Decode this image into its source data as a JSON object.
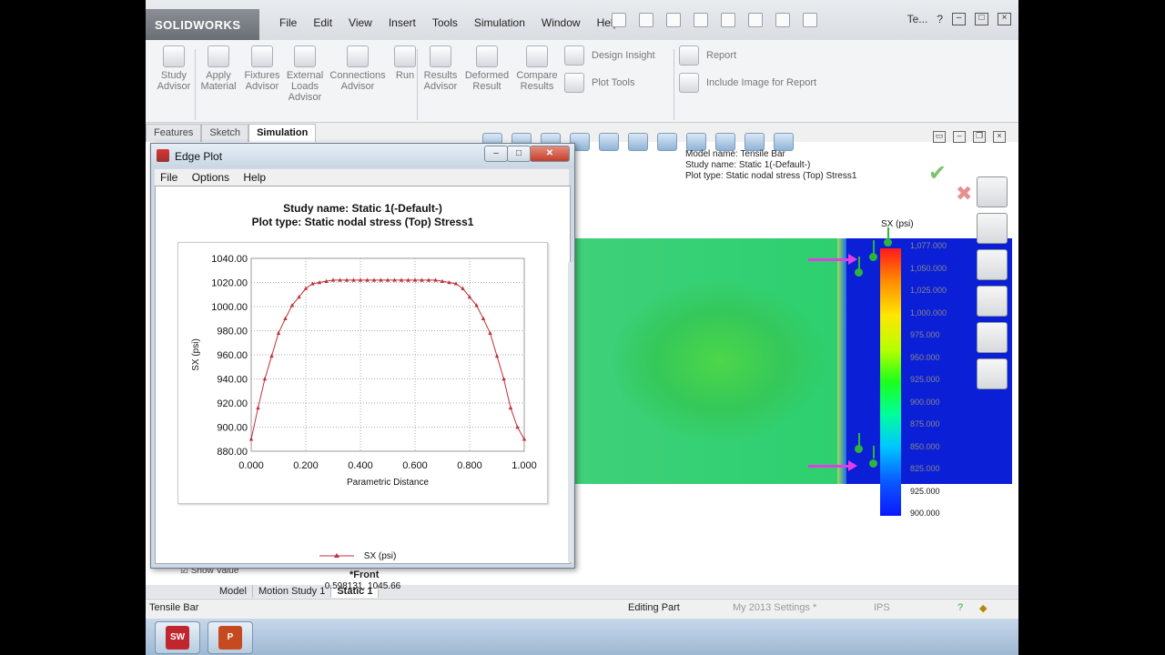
{
  "app": {
    "logo_text": "SOLIDWORKS",
    "menus": [
      "File",
      "Edit",
      "View",
      "Insert",
      "Tools",
      "Simulation",
      "Window",
      "Help"
    ],
    "doc_short": "Te...",
    "help_icon": "?"
  },
  "ribbon": {
    "buttons": [
      {
        "label": "Study\nAdvisor",
        "icon": "study-advisor-icon"
      },
      {
        "label": "Apply\nMaterial",
        "icon": "material-icon"
      },
      {
        "label": "Fixtures\nAdvisor",
        "icon": "fixtures-icon"
      },
      {
        "label": "External\nLoads\nAdvisor",
        "icon": "loads-icon"
      },
      {
        "label": "Connections\nAdvisor",
        "icon": "connections-icon"
      },
      {
        "label": "Run",
        "icon": "run-icon"
      },
      {
        "label": "Results\nAdvisor",
        "icon": "results-icon"
      },
      {
        "label": "Deformed\nResult",
        "icon": "deformed-icon"
      },
      {
        "label": "Compare\nResults",
        "icon": "compare-icon"
      }
    ],
    "design_insight": "Design Insight",
    "plot_tools": "Plot Tools",
    "report": "Report",
    "include_image": "Include Image for Report"
  },
  "tabs": [
    "Features",
    "Sketch",
    "Simulation"
  ],
  "model_info": {
    "line1": "Model name: Tensile Bar",
    "line2": "Study name: Static 1(-Default-)",
    "line3": "Plot type: Static nodal stress (Top) Stress1"
  },
  "legend": {
    "title": "SX (psi)",
    "values": [
      "1,077.000",
      "1,050.000",
      "1,025.000",
      "1,000.000",
      "975.000",
      "950.000",
      "925.000",
      "900.000",
      "875.000",
      "850.000",
      "825.000",
      "925.000",
      "900.000"
    ],
    "visible_bottom": [
      "925.000",
      "900.000"
    ],
    "high_color": "#ff1a1a",
    "low_color": "#0a18ff"
  },
  "edge_plot": {
    "window_title": "Edge Plot",
    "menus": [
      "File",
      "Options",
      "Help"
    ],
    "title_line1": "Study name: Static 1(-Default-)",
    "title_line2": "Plot type: Static nodal stress (Top) Stress1",
    "legend_label": "SX (psi)",
    "cursor_readout": "0.598131, 1045.66"
  },
  "chart_data": {
    "type": "line",
    "xlabel": "Parametric Distance",
    "ylabel": "SX (psi)",
    "xlim": [
      0,
      1
    ],
    "ylim": [
      880,
      1040
    ],
    "x_ticks": [
      "0.000",
      "0.200",
      "0.400",
      "0.600",
      "0.800",
      "1.000"
    ],
    "y_ticks": [
      "880.00",
      "900.00",
      "920.00",
      "940.00",
      "960.00",
      "980.00",
      "1000.00",
      "1020.00",
      "1040.00"
    ],
    "series": [
      {
        "name": "SX (psi)",
        "color": "#c0303a",
        "x": [
          0.0,
          0.025,
          0.05,
          0.075,
          0.1,
          0.125,
          0.15,
          0.175,
          0.2,
          0.225,
          0.25,
          0.275,
          0.3,
          0.325,
          0.35,
          0.375,
          0.4,
          0.425,
          0.45,
          0.475,
          0.5,
          0.525,
          0.55,
          0.575,
          0.6,
          0.625,
          0.65,
          0.675,
          0.7,
          0.725,
          0.75,
          0.775,
          0.8,
          0.825,
          0.85,
          0.875,
          0.9,
          0.925,
          0.95,
          0.975,
          1.0
        ],
        "y": [
          890,
          916,
          940,
          959,
          978,
          990,
          1001,
          1008,
          1015,
          1019,
          1020,
          1021,
          1022,
          1022,
          1022,
          1022,
          1022,
          1022,
          1022,
          1022,
          1022,
          1022,
          1022,
          1022,
          1022,
          1022,
          1022,
          1022,
          1021,
          1020,
          1019,
          1015,
          1008,
          1001,
          990,
          978,
          959,
          940,
          916,
          900,
          890
        ]
      }
    ],
    "legend_position": "bottom",
    "grid": true
  },
  "status": {
    "left": "Tensile Bar",
    "mode": "Editing Part",
    "settings": "My 2013 Settings *",
    "units": "IPS"
  },
  "bottom_tabs": [
    "Model",
    "Motion Study 1",
    "Static 1"
  ],
  "view_label": "*Front",
  "show_value": "Show Value"
}
